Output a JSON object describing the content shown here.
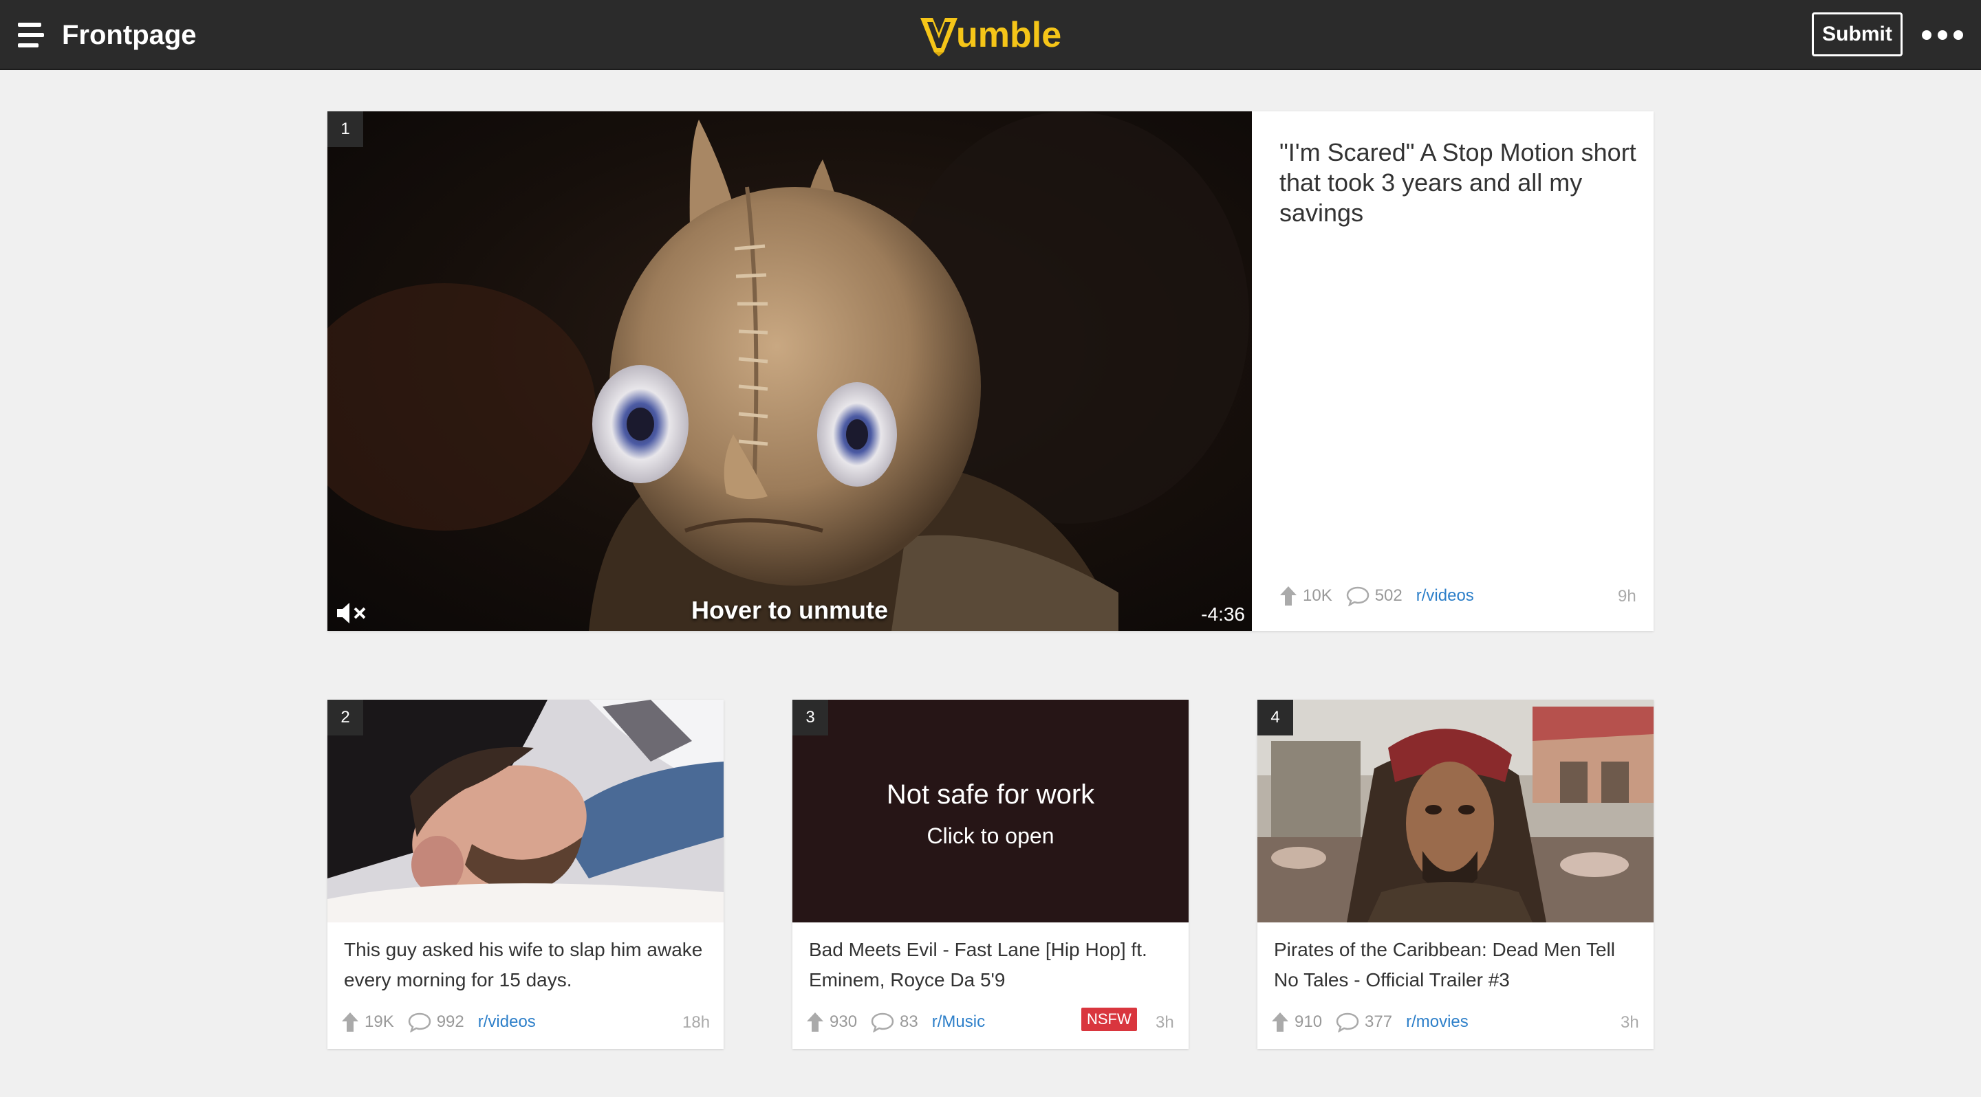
{
  "header": {
    "page_title": "Frontpage",
    "logo_text": "umble",
    "submit_label": "Submit"
  },
  "colors": {
    "brand": "#f5c518",
    "topbar": "#2b2b2b",
    "link": "#2d7fc9",
    "nsfw_badge": "#d9363e"
  },
  "featured": {
    "rank": "1",
    "title": "\"I'm Scared\" A Stop Motion short that took 3 years and all my savings",
    "overlay_text": "Hover to unmute",
    "time_left": "-4:36",
    "upvotes": "10K",
    "comments": "502",
    "subreddit": "r/videos",
    "age": "9h"
  },
  "cards": [
    {
      "rank": "2",
      "title": "This guy asked his wife to slap him awake every morning for 15 days.",
      "upvotes": "19K",
      "comments": "992",
      "subreddit": "r/videos",
      "age": "18h"
    },
    {
      "rank": "3",
      "nsfw_title": "Not safe for work",
      "nsfw_sub": "Click to open",
      "title": "Bad Meets Evil - Fast Lane [Hip Hop] ft. Eminem, Royce Da 5'9",
      "upvotes": "930",
      "comments": "83",
      "subreddit": "r/Music",
      "badge": "NSFW",
      "age": "3h"
    },
    {
      "rank": "4",
      "title": "Pirates of the Caribbean: Dead Men Tell No Tales - Official Trailer #3",
      "upvotes": "910",
      "comments": "377",
      "subreddit": "r/movies",
      "age": "3h"
    }
  ],
  "icons": [
    "hamburger-icon",
    "vumble-logo-icon",
    "more-icon",
    "mute-icon",
    "upvote-arrow-icon",
    "comment-icon"
  ]
}
